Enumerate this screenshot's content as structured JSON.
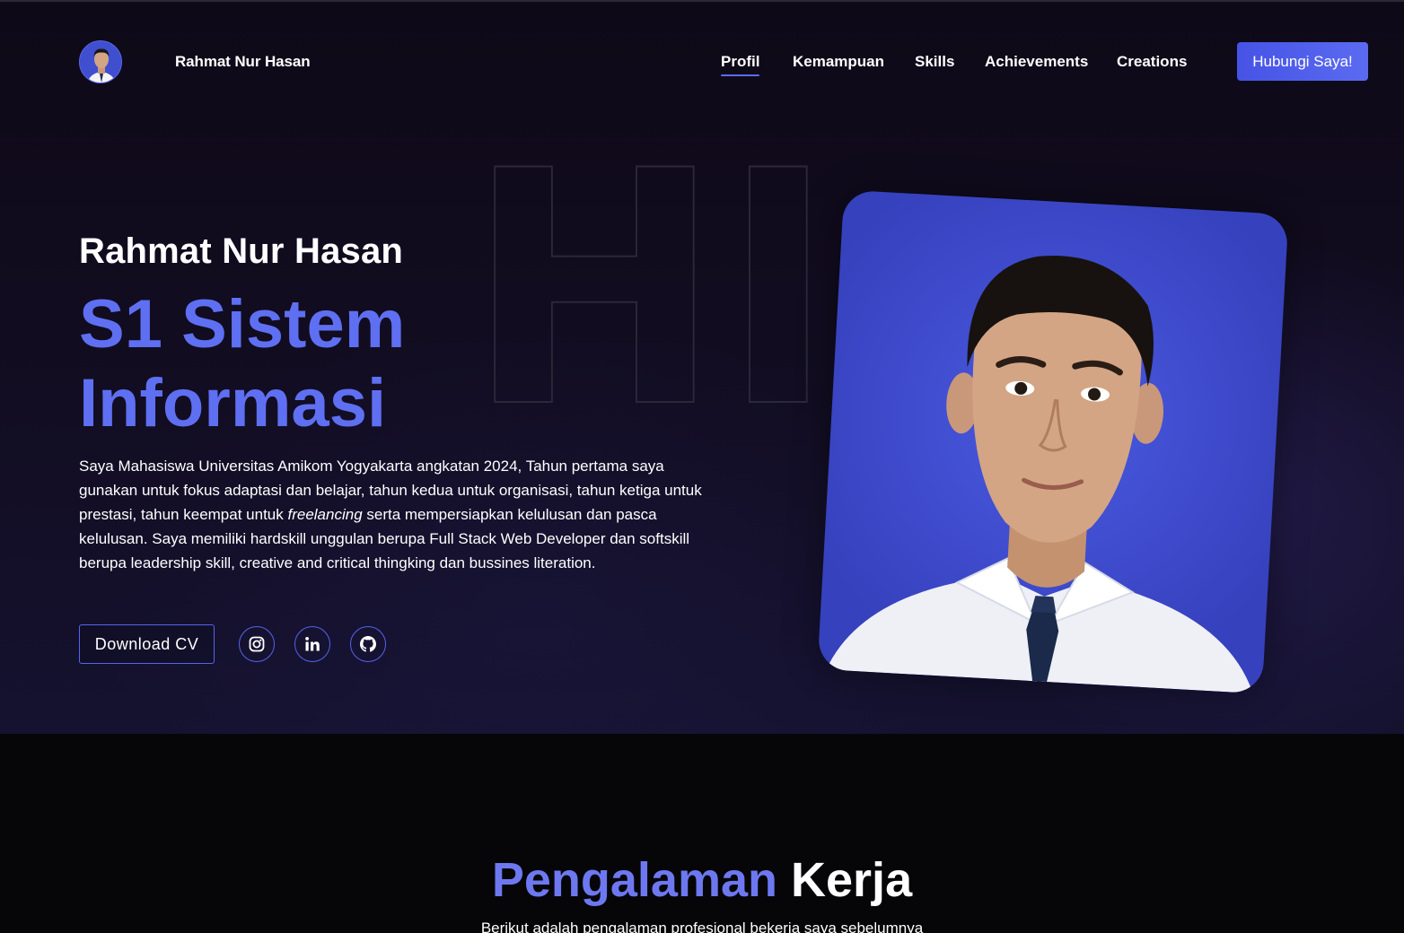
{
  "navbar": {
    "brand": "Rahmat Nur Hasan",
    "links": [
      {
        "label": "Profil",
        "active": true
      },
      {
        "label": "Kemampuan",
        "active": false
      },
      {
        "label": "Skills",
        "active": false
      },
      {
        "label": "Achievements",
        "active": false
      },
      {
        "label": "Creations",
        "active": false
      }
    ],
    "cta_label": "Hubungi Saya!"
  },
  "hero": {
    "background_text": "HI",
    "name": "Rahmat Nur Hasan",
    "title_line1": "S1 Sistem",
    "title_line2": "Informasi",
    "description_part1": "Saya Mahasiswa Universitas Amikom Yogyakarta angkatan 2024, Tahun pertama saya gunakan untuk fokus adaptasi dan belajar, tahun kedua untuk organisasi, tahun ketiga untuk prestasi, tahun keempat untuk ",
    "description_emphasis": "freelancing",
    "description_part2": " serta mempersiapkan kelulusan dan pasca kelulusan. Saya memiliki hardskill unggulan berupa Full Stack Web Developer dan softskill berupa leadership skill, creative and critical thingking dan bussines literation.",
    "download_label": "Download CV",
    "socials": [
      {
        "icon": "instagram-icon"
      },
      {
        "icon": "linkedin-icon"
      },
      {
        "icon": "github-icon"
      }
    ]
  },
  "experience": {
    "title_word1": "Pengalaman",
    "title_word2": "Kerja",
    "subtitle": "Berikut adalah pengalaman profesional bekerja saya sebelumnya"
  },
  "colors": {
    "accent": "#5b6cf5",
    "photo_bg": "#3f4fd0",
    "hero_bg": "#0e0917"
  }
}
